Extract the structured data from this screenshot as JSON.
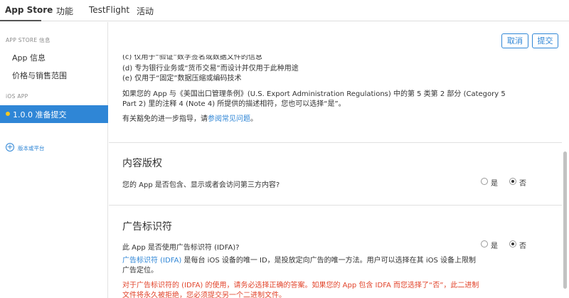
{
  "topnav": {
    "tabs": [
      "App Store",
      "功能",
      "TestFlight",
      "活动"
    ]
  },
  "sidebar": {
    "section_appstore": "APP STORE 信息",
    "item_app_info": "App 信息",
    "item_pricing": "价格与销售范围",
    "section_ios": "iOS APP",
    "active_version": "1.0.0 准备提交",
    "add_platform": "版本或平台"
  },
  "header": {
    "cancel": "取消",
    "submit": "提交"
  },
  "encryption": {
    "line_c_partial": "(c) 仅用于“验证”数字签名或数据文件的信息",
    "line_d": "(d) 专为银行业务或“货币交易”而设计并仅用于此种用途",
    "line_e": "(e) 仅用于“固定”数据压缩或编码技术",
    "para1_line1": "如果您的 App 与《美国出口管理条例》(U.S. Export Administration Regulations) 中的第 5 类第 2 部分 (Category 5",
    "para1_line2": "Part 2) 里的注释 4 (Note 4) 所提供的描述相符，您也可以选择“是”。",
    "guidance_prefix": "有关豁免的进一步指导，请",
    "guidance_link": "参阅常见问题",
    "guidance_suffix": "。"
  },
  "content_rights": {
    "title": "内容版权",
    "question": "您的 App 是否包含、显示或者会访问第三方内容?",
    "yes": "是",
    "no": "否",
    "selected": "否"
  },
  "idfa": {
    "title": "广告标识符",
    "question": "此 App 是否使用广告标识符 (IDFA)?",
    "desc_link": "广告标识符 (IDFA)",
    "desc_line1": " 是每台 iOS 设备的唯一 ID，是投放定向广告的唯一方法。用户可以选择在其 iOS 设备上限制",
    "desc_line2": "广告定位。",
    "warn_line1": "对于广告标识符的 (IDFA) 的使用，请务必选择正确的答案。如果您的 App 包含 IDFA 而您选择了“否”，此二进制",
    "warn_line2": "文件将永久被拒绝，您必须提交另一个二进制文件。",
    "yes": "是",
    "no": "否",
    "selected": "否"
  },
  "colors": {
    "accent": "#2f86d6",
    "warning": "#e2442b",
    "status_dot": "#f5c722"
  }
}
